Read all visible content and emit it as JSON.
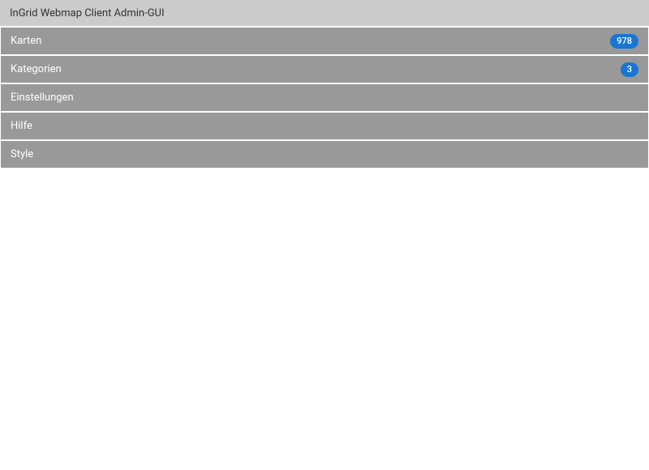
{
  "header": {
    "title": "InGrid Webmap Client Admin-GUI"
  },
  "menu": {
    "items": [
      {
        "label": "Karten",
        "badge": "978"
      },
      {
        "label": "Kategorien",
        "badge": "3"
      },
      {
        "label": "Einstellungen",
        "badge": null
      },
      {
        "label": "Hilfe",
        "badge": null
      },
      {
        "label": "Style",
        "badge": null
      }
    ]
  }
}
